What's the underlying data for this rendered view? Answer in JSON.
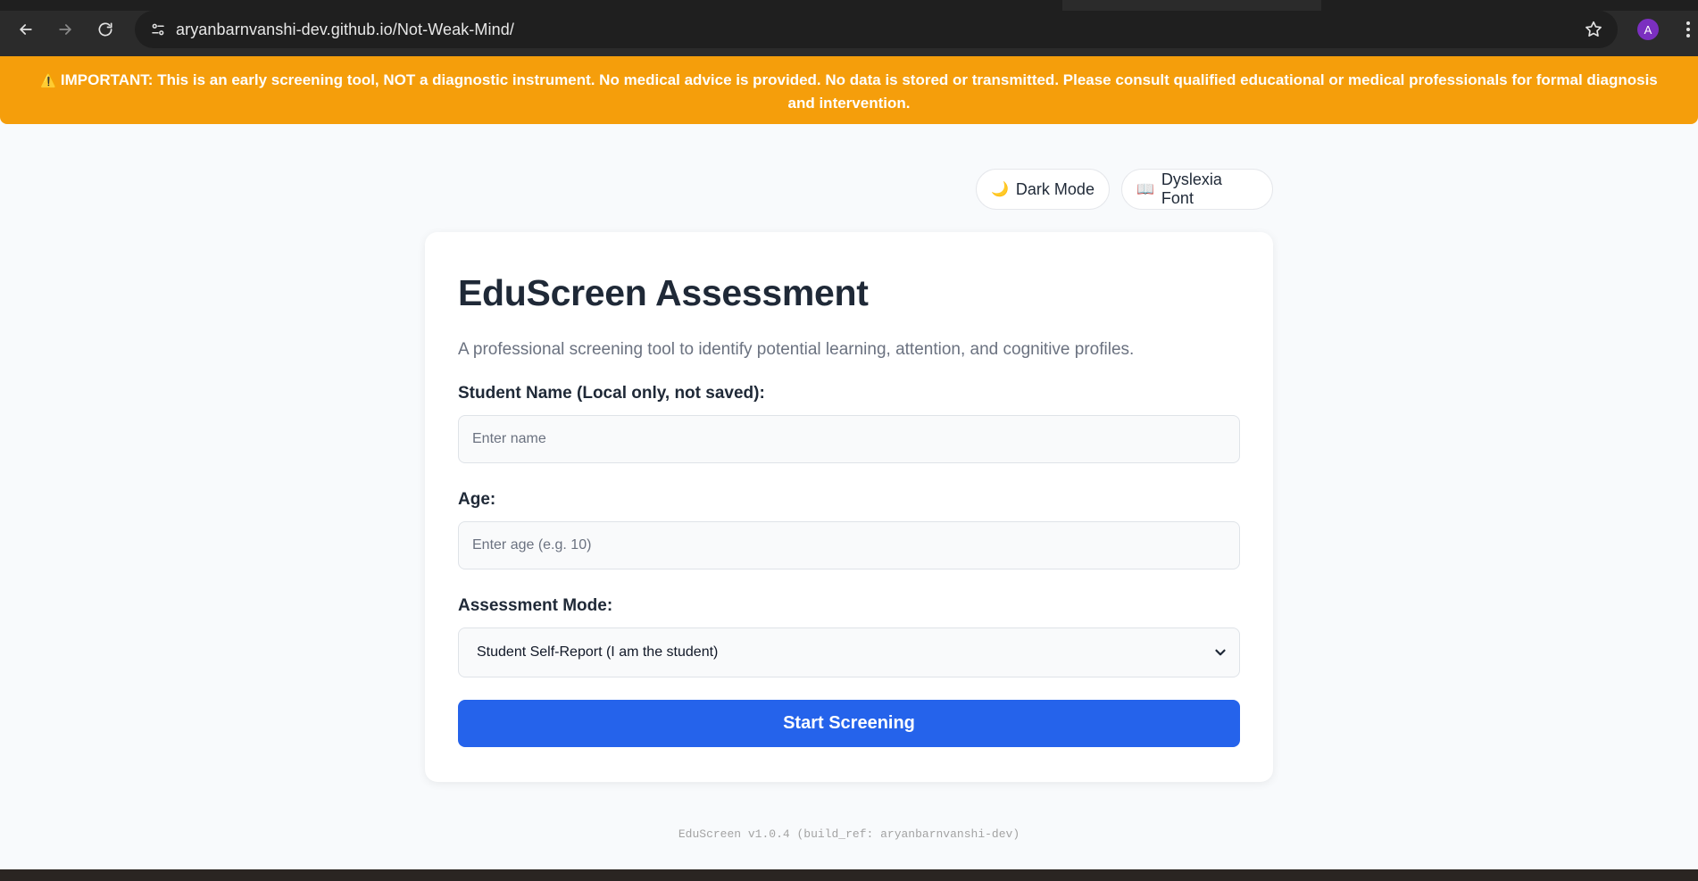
{
  "browser": {
    "url": "aryanbarnvanshi-dev.github.io/Not-Weak-Mind/",
    "profile_initial": "A"
  },
  "banner": {
    "icon": "warning-icon",
    "text": "IMPORTANT: This is an early screening tool, NOT a diagnostic instrument. No medical advice is provided. No data is stored or transmitted. Please consult qualified educational or medical professionals for formal diagnosis and intervention.",
    "color": "#f59e0b"
  },
  "toolbar": {
    "dark_mode_label": "Dark Mode",
    "dark_mode_icon": "moon-icon",
    "dyslexia_label": "Dyslexia Font",
    "dyslexia_icon": "book-icon"
  },
  "form": {
    "title": "EduScreen Assessment",
    "description": "A professional screening tool to identify potential learning, attention, and cognitive profiles.",
    "name_label": "Student Name (Local only, not saved):",
    "name_placeholder": "Enter name",
    "name_value": "",
    "age_label": "Age:",
    "age_placeholder": "Enter age (e.g. 10)",
    "age_value": "",
    "mode_label": "Assessment Mode:",
    "mode_selected": "Student Self-Report (I am the student)",
    "start_label": "Start Screening",
    "accent_color": "#2563eb"
  },
  "footer": {
    "text": "EduScreen v1.0.4 (build_ref: aryanbarnvanshi-dev)"
  }
}
